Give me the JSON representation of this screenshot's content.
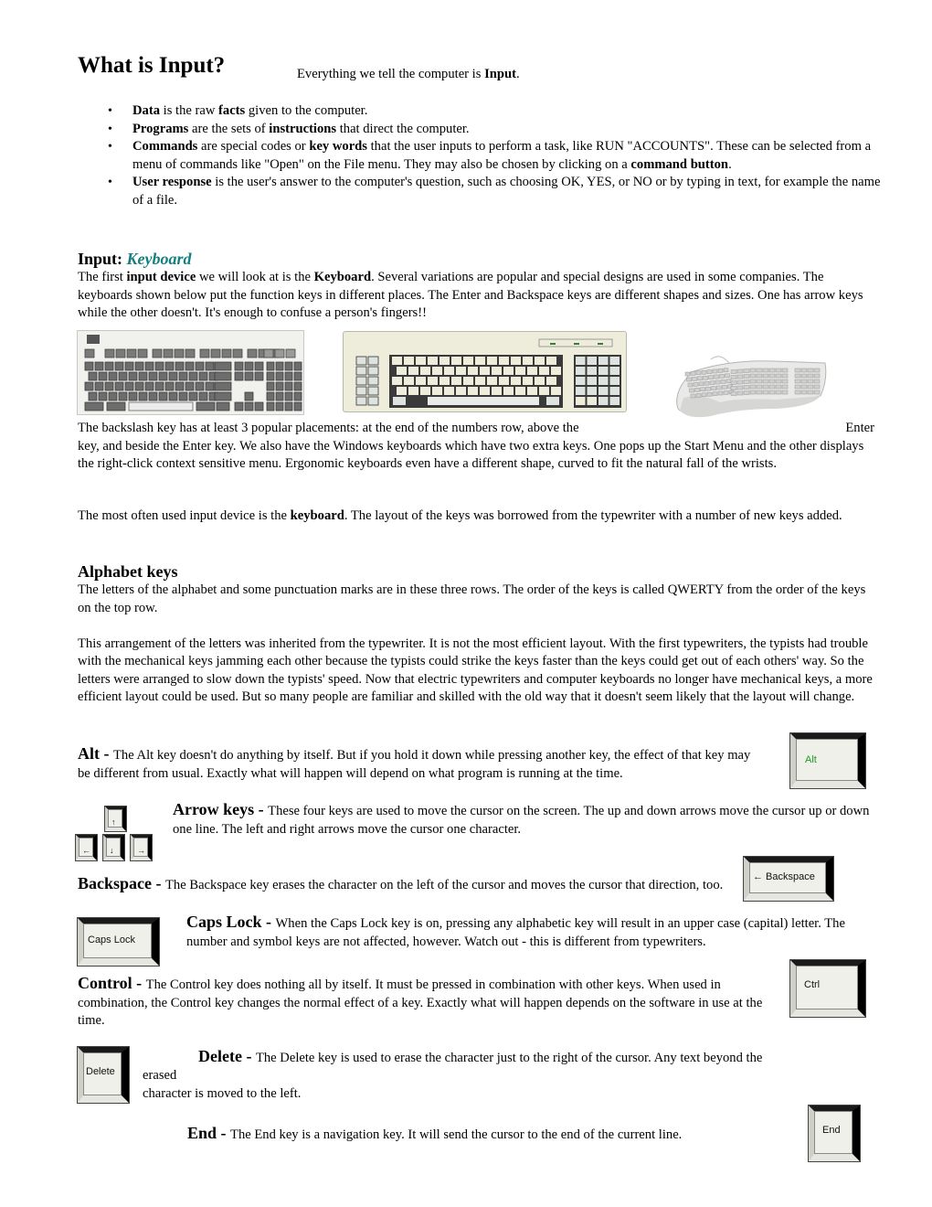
{
  "header": {
    "title": "What is Input?",
    "subtitle_prefix": "Everything we tell the computer is ",
    "subtitle_bold": "Input",
    "subtitle_suffix": "."
  },
  "bullets": [
    {
      "segments": [
        {
          "b": "Data"
        },
        {
          "t": " is the raw "
        },
        {
          "b": "facts"
        },
        {
          "t": " given to the computer."
        }
      ]
    },
    {
      "segments": [
        {
          "b": "Programs"
        },
        {
          "t": " are the sets of "
        },
        {
          "b": "instructions"
        },
        {
          "t": " that direct the computer."
        }
      ]
    },
    {
      "segments": [
        {
          "b": "Commands"
        },
        {
          "t": " are special codes or "
        },
        {
          "b": "key words"
        },
        {
          "t": " that the user inputs to perform a task, like RUN \"ACCOUNTS\". These can be selected from a menu of commands like \"Open\" on the File menu. They may also be chosen by clicking on a "
        },
        {
          "b": "command button"
        },
        {
          "t": "."
        }
      ]
    },
    {
      "segments": [
        {
          "b": "User response"
        },
        {
          "t": " is the user's answer to the computer's question, such as choosing OK, YES, or NO or by typing in text, for example the name of a file."
        }
      ]
    }
  ],
  "keyboard_section": {
    "heading_prefix": "Input: ",
    "heading_accent": "Keyboard",
    "accent_color": "#128080",
    "intro": [
      {
        "t": "The first "
      },
      {
        "b": "input device"
      },
      {
        "t": " we will look at is the "
      },
      {
        "b": "Keyboard"
      },
      {
        "t": ". Several variations are popular and special designs are used in some companies. The keyboards shown below put the function keys in different places. The Enter and Backspace keys are different shapes and sizes. One has arrow keys while the other doesn't. It's enough to confuse a person's fingers!!"
      }
    ],
    "images": [
      "standard-keyboard-image",
      "older-keyboard-image",
      "ergonomic-keyboard-image"
    ],
    "backslash_line1": "The backslash key has at least 3 popular placements: at the end of the numbers row, above the",
    "backslash_enter": "Enter",
    "backslash_rest": "key, and beside the Enter key. We also have the Windows keyboards which have two extra keys. One pops up the Start Menu and the other displays the right-click context sensitive menu. Ergonomic keyboards even have a different shape, curved to fit the natural fall of the wrists.",
    "most_used": [
      {
        "t": "The most often used input device is the "
      },
      {
        "b": "keyboard"
      },
      {
        "t": ". The layout of the keys was borrowed from the typewriter with a number of new keys added."
      }
    ]
  },
  "alphabet_section": {
    "heading": "Alphabet keys",
    "para1": "The letters of the alphabet and some punctuation marks are in these three rows. The order of the keys is called QWERTY from the order of the keys on the top row.",
    "para2": "This arrangement of the letters was inherited from the typewriter. It is not the most efficient layout. With the first typewriters, the typists had trouble with the mechanical keys jamming each other because the typists could strike the keys faster than the keys could get out of each others' way. So the letters were arranged to slow down the typists' speed. Now that electric typewriters and computer keyboards no longer have mechanical keys, a more efficient layout could be used. But so many people are familiar and skilled with the old way that it doesn't seem likely that the layout will change."
  },
  "keys": {
    "alt": {
      "name": "Alt",
      "sep": " - ",
      "desc": "The Alt key doesn't do anything by itself. But if you hold it down while pressing another key, the effect of that key may be different from usual. Exactly what will happen will depend on what program is running at the time.",
      "key_label": "Alt",
      "key_label_color": "#1f9a1f"
    },
    "arrows": {
      "name": "Arrow keys",
      "sep": " - ",
      "desc": "These four keys are used to move the cursor on the screen. The up and down arrows move the cursor up or down one line. The left and right arrows move the cursor one character.",
      "up": "↑",
      "left": "←",
      "down": "↓",
      "right": "→"
    },
    "backspace": {
      "name": "Backspace",
      "sep": " - ",
      "desc": "The Backspace key erases the character on the left of the cursor and moves the cursor that direction, too.",
      "key_label": "← Backspace"
    },
    "capslock": {
      "name": "Caps Lock",
      "sep": " - ",
      "desc": "When the Caps Lock key is on, pressing any alphabetic key will result in an upper case (capital) letter. The number and symbol keys are not affected, however. Watch out - this is different from typewriters.",
      "key_label": "Caps Lock"
    },
    "control": {
      "name": "Control",
      "sep": " - ",
      "desc": "The Control key does nothing all by itself. It must be pressed in combination with other keys. When used in combination, the Control key changes the normal effect of a key. Exactly what will happen depends on the software in use at the time.",
      "key_label": "Ctrl"
    },
    "delete": {
      "name": "Delete",
      "sep": " - ",
      "desc": "The Delete key is used to erase the character just to the right of the cursor. Any text beyond the",
      "desc2": "erased",
      "desc3": "character is moved to the left.",
      "key_label": "Delete"
    },
    "end": {
      "name": "End",
      "sep": " - ",
      "desc": "The End key is a navigation key. It will send the cursor to the end of the current line.",
      "key_label": "End"
    }
  }
}
